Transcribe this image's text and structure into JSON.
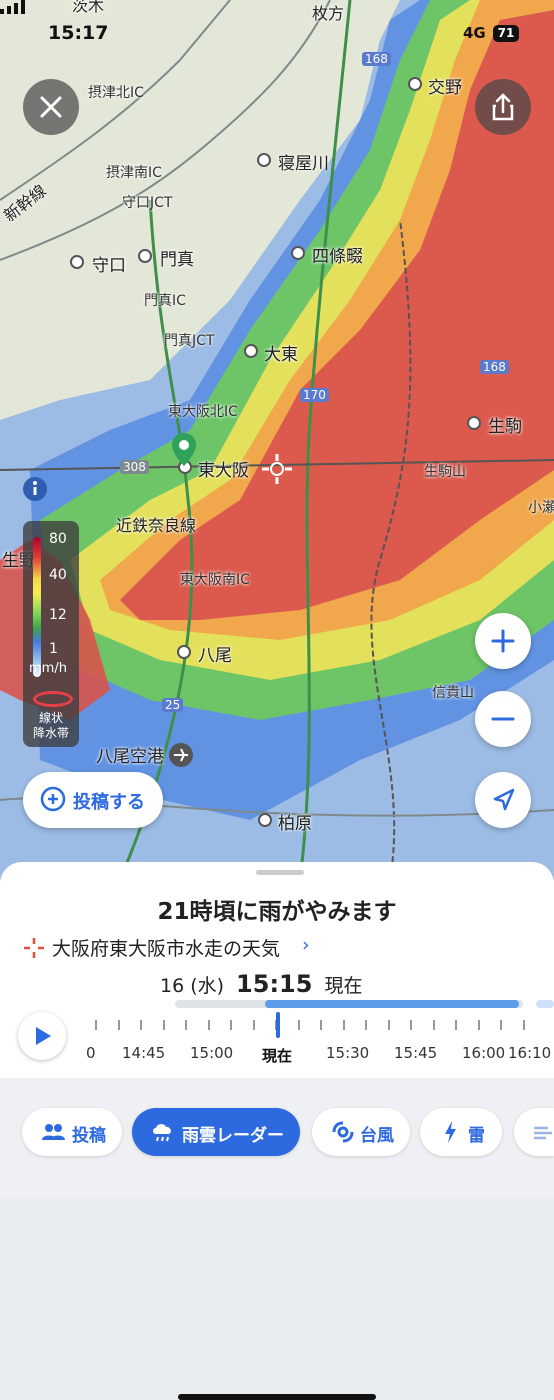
{
  "status": {
    "time": "15:17",
    "network": "4G",
    "battery": "71"
  },
  "map": {
    "places": [
      {
        "name": "枚方",
        "kind": "city"
      },
      {
        "name": "交野",
        "kind": "city"
      },
      {
        "name": "寝屋川",
        "kind": "city"
      },
      {
        "name": "四條畷",
        "kind": "city"
      },
      {
        "name": "守口",
        "kind": "city"
      },
      {
        "name": "門真",
        "kind": "city"
      },
      {
        "name": "大東",
        "kind": "city"
      },
      {
        "name": "生駒",
        "kind": "city"
      },
      {
        "name": "東大阪",
        "kind": "city"
      },
      {
        "name": "八尾",
        "kind": "city"
      },
      {
        "name": "柏原",
        "kind": "city"
      },
      {
        "name": "生野",
        "kind": "city"
      }
    ],
    "interchanges": [
      "摂津北IC",
      "摂津南IC",
      "守口JCT",
      "門真IC",
      "門真JCT",
      "東大阪北IC",
      "東大阪南IC",
      "生駒山",
      "小瀬",
      "信貴山"
    ],
    "other_labels": {
      "railway": "近鉄奈良線",
      "shinkansen": "新幹線",
      "airport": "八尾空港",
      "route_308": "308",
      "route_170": "170",
      "route_168a": "168",
      "route_168b": "168",
      "route_25": "25",
      "top_partial": "茨木"
    }
  },
  "legend": {
    "values": [
      "80",
      "40",
      "12",
      "1"
    ],
    "unit": "mm/h",
    "band_label_line1": "線状",
    "band_label_line2": "降水帯"
  },
  "post_button_label": "投稿する",
  "sheet": {
    "headline": "21時頃に雨がやみます",
    "location": "大阪府東大阪市水走の天気",
    "date": "16 (水)",
    "clock": "15:15",
    "current_label": "現在",
    "timeline_labels": [
      "0",
      "14:45",
      "15:00",
      "現在",
      "15:30",
      "15:45",
      "16:00",
      "16:10"
    ]
  },
  "tabs": [
    {
      "label": "投稿",
      "icon": "people-icon"
    },
    {
      "label": "雨雲レーダー",
      "icon": "rain-cloud-icon",
      "active": true
    },
    {
      "label": "台風",
      "icon": "typhoon-icon"
    },
    {
      "label": "雷",
      "icon": "lightning-icon"
    },
    {
      "label": "",
      "icon": "wind-icon"
    }
  ],
  "colors": {
    "accent": "#2d6adf",
    "rain_heavy": "#d9544d",
    "rain_strong": "#f0cf4a",
    "rain_moderate": "#6fcb5a",
    "rain_light": "#4e86e0"
  }
}
